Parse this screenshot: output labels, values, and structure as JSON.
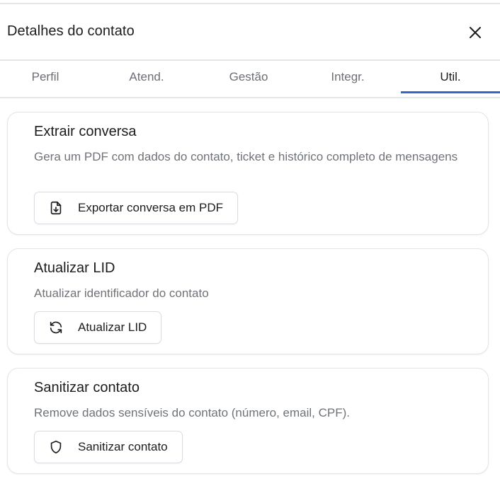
{
  "header": {
    "title": "Detalhes do contato"
  },
  "tabs": [
    {
      "label": "Perfil",
      "active": false
    },
    {
      "label": "Atend.",
      "active": false
    },
    {
      "label": "Gestão",
      "active": false
    },
    {
      "label": "Integr.",
      "active": false
    },
    {
      "label": "Util.",
      "active": true
    }
  ],
  "cards": [
    {
      "title": "Extrair conversa",
      "description": "Gera um PDF com dados do contato, ticket e histórico completo de mensagens",
      "button": {
        "label": "Exportar conversa em PDF",
        "icon": "file-download-icon"
      }
    },
    {
      "title": "Atualizar LID",
      "description": "Atualizar identificador do contato",
      "button": {
        "label": "Atualizar LID",
        "icon": "refresh-icon"
      }
    },
    {
      "title": "Sanitizar contato",
      "description": "Remove dados sensíveis do contato (número, email, CPF).",
      "button": {
        "label": "Sanitizar contato",
        "icon": "shield-icon"
      }
    }
  ],
  "colors": {
    "accent": "#3566c9",
    "border": "#e2e4e8",
    "muted_text": "#6f7378"
  }
}
